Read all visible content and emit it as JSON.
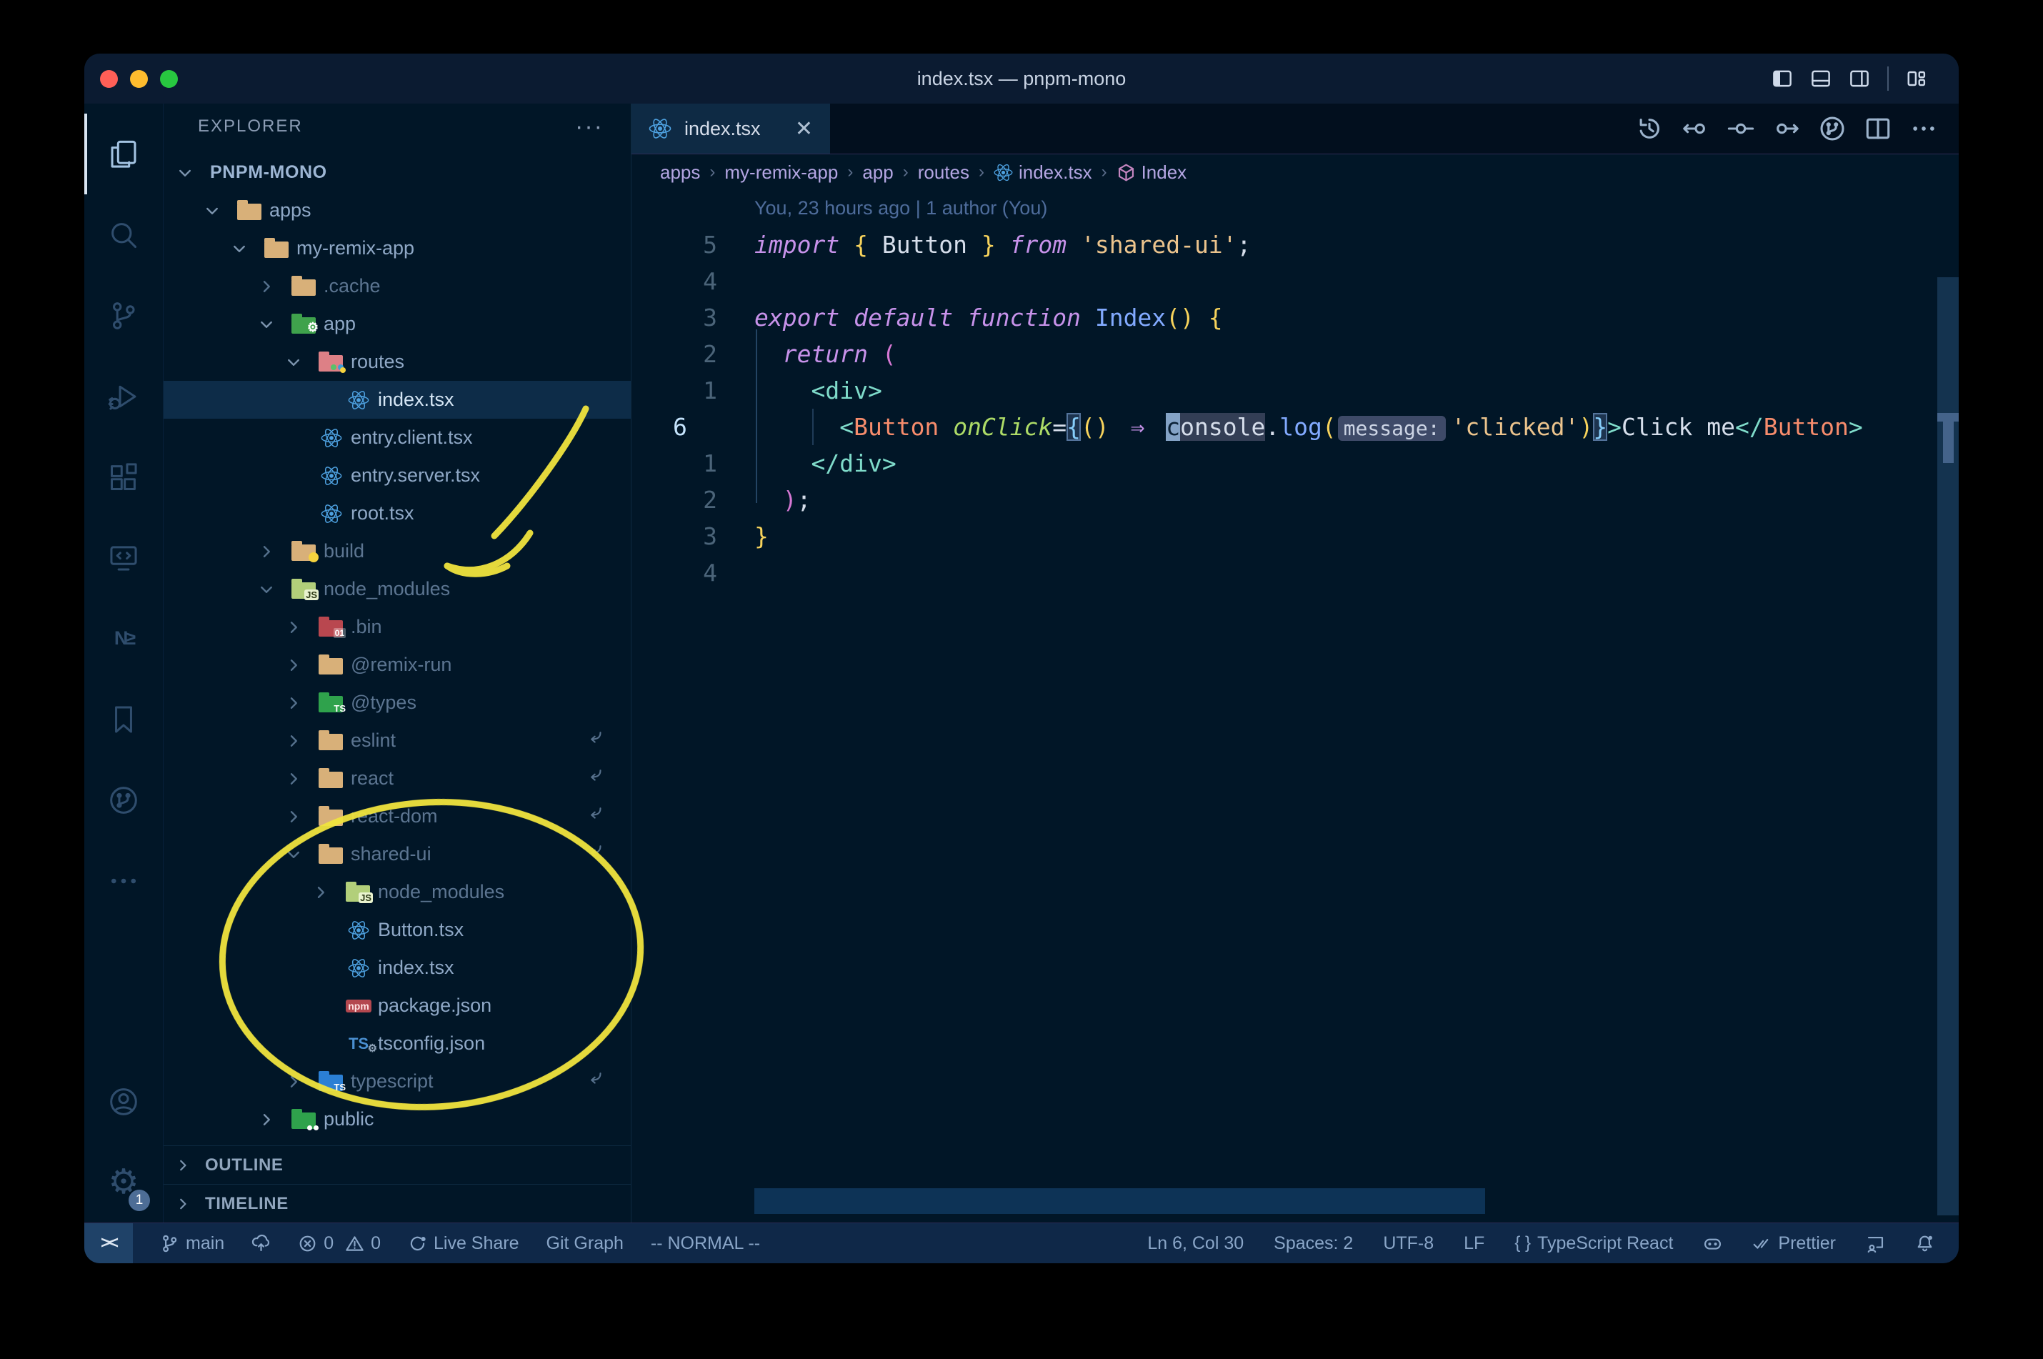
{
  "window": {
    "title": "index.tsx — pnpm-mono"
  },
  "titlebar": {
    "traffic_lights": [
      "#ff5f57",
      "#febc2e",
      "#28c840"
    ],
    "right_icons": [
      "layout-sidebar-left",
      "layout-panel",
      "layout-sidebar-right",
      "sep",
      "layout-custom"
    ]
  },
  "activity_bar": {
    "items": [
      {
        "id": "explorer",
        "icon": "files",
        "active": true
      },
      {
        "id": "search",
        "icon": "search"
      },
      {
        "id": "source-control",
        "icon": "scm"
      },
      {
        "id": "run-debug",
        "icon": "debug"
      },
      {
        "id": "extensions",
        "icon": "ext"
      },
      {
        "id": "remote-explorer",
        "icon": "remote"
      },
      {
        "id": "nx-console",
        "icon": "nx"
      },
      {
        "id": "bookmarks",
        "icon": "bookmarks"
      },
      {
        "id": "git-graph",
        "icon": "gitgraph"
      },
      {
        "id": "more-views",
        "icon": "more"
      },
      {
        "id": "accounts",
        "icon": "account",
        "bottom": true
      },
      {
        "id": "settings",
        "icon": "gear",
        "bottom": true,
        "badge": "1"
      }
    ]
  },
  "sidebar": {
    "header": "EXPLORER",
    "more": "···",
    "sections": [
      {
        "label": "OUTLINE"
      },
      {
        "label": "TIMELINE"
      }
    ],
    "icon_colors": {
      "tan": "#d8b079",
      "green": "#3fa24c",
      "pink": "#dd8086",
      "olive": "#b2cf7a",
      "red": "#b9474f",
      "green2": "#2fa24c",
      "blue": "#2b7fd4"
    },
    "tree": [
      {
        "label": "PNPM-MONO",
        "level": 0,
        "chev": "down",
        "root": true
      },
      {
        "label": "apps",
        "level": 1,
        "chev": "down",
        "icon": "folder",
        "color": "tan"
      },
      {
        "label": "my-remix-app",
        "level": 2,
        "chev": "down",
        "icon": "folder",
        "color": "tan"
      },
      {
        "label": ".cache",
        "level": 3,
        "chev": "right",
        "icon": "folder",
        "color": "tan",
        "dim": true
      },
      {
        "label": "app",
        "level": 3,
        "chev": "down",
        "icon": "folder",
        "color": "green",
        "badge": "gear"
      },
      {
        "label": "routes",
        "level": 4,
        "chev": "down",
        "icon": "folder",
        "color": "pink",
        "badge": "dots"
      },
      {
        "label": "index.tsx",
        "level": 5,
        "icon": "react",
        "selected": true
      },
      {
        "label": "entry.client.tsx",
        "level": 4,
        "icon": "react"
      },
      {
        "label": "entry.server.tsx",
        "level": 4,
        "icon": "react"
      },
      {
        "label": "root.tsx",
        "level": 4,
        "icon": "react"
      },
      {
        "label": "build",
        "level": 3,
        "chev": "right",
        "icon": "folder",
        "color": "tan",
        "badge": "circle",
        "dim": true
      },
      {
        "label": "node_modules",
        "level": 3,
        "chev": "down",
        "icon": "folder",
        "color": "olive",
        "badge": "js",
        "dim": true
      },
      {
        "label": ".bin",
        "level": 4,
        "chev": "right",
        "icon": "folder",
        "color": "red",
        "badge": "bin",
        "dim": true
      },
      {
        "label": "@remix-run",
        "level": 4,
        "chev": "right",
        "icon": "folder",
        "color": "tan",
        "dim": true
      },
      {
        "label": "@types",
        "level": 4,
        "chev": "right",
        "icon": "folder",
        "color": "green2",
        "badge": "TS",
        "dim": true
      },
      {
        "label": "eslint",
        "level": 4,
        "chev": "right",
        "icon": "folder",
        "color": "tan",
        "dim": true,
        "symlink": true
      },
      {
        "label": "react",
        "level": 4,
        "chev": "right",
        "icon": "folder",
        "color": "tan",
        "dim": true,
        "symlink": true
      },
      {
        "label": "react-dom",
        "level": 4,
        "chev": "right",
        "icon": "folder",
        "color": "tan",
        "dim": true,
        "symlink": true
      },
      {
        "label": "shared-ui",
        "level": 4,
        "chev": "down",
        "icon": "folder",
        "color": "tan",
        "dim": true,
        "symlink": true
      },
      {
        "label": "node_modules",
        "level": 5,
        "chev": "right",
        "icon": "folder",
        "color": "olive",
        "badge": "js",
        "dim": true
      },
      {
        "label": "Button.tsx",
        "level": 5,
        "icon": "react"
      },
      {
        "label": "index.tsx",
        "level": 5,
        "icon": "react"
      },
      {
        "label": "package.json",
        "level": 5,
        "icon": "npm"
      },
      {
        "label": "tsconfig.json",
        "level": 5,
        "icon": "tsgear"
      },
      {
        "label": "typescript",
        "level": 4,
        "chev": "right",
        "icon": "folder",
        "color": "blue",
        "badge": "TS",
        "dim": true,
        "symlink": true
      },
      {
        "label": "public",
        "level": 3,
        "chev": "right",
        "icon": "folder",
        "color": "green2",
        "badge": "people"
      }
    ]
  },
  "editor": {
    "tab": {
      "label": "index.tsx",
      "close": "✕"
    },
    "actions": [
      "history",
      "commit-back",
      "commit",
      "commit-fwd",
      "gitgraph",
      "split",
      "more"
    ],
    "breadcrumbs": [
      {
        "label": "apps"
      },
      {
        "label": "my-remix-app"
      },
      {
        "label": "app"
      },
      {
        "label": "routes"
      },
      {
        "label": "index.tsx",
        "icon": "react"
      },
      {
        "label": "Index",
        "icon": "cube"
      }
    ],
    "colors": {
      "kw": "#c792ea",
      "fg": "#d6deeb",
      "fn": "#82aaff",
      "str": "#ecc48d",
      "tag": "#7fdbca",
      "comp": "#f78c6c",
      "attr": "#addb67",
      "b1": "#f7d35c",
      "b2": "#d678d4",
      "b3": "#87cefa"
    },
    "code_lines": [
      {
        "blame": true,
        "text": "You, 23 hours ago | 1 author (You)"
      },
      {
        "n": "5",
        "tokens": [
          [
            "import ",
            "kw",
            1
          ],
          [
            "{ ",
            "b1"
          ],
          [
            "Button ",
            "fg"
          ],
          [
            "} ",
            "b1"
          ],
          [
            "from ",
            "kw",
            1
          ],
          [
            "'shared-ui'",
            "str"
          ],
          [
            ";",
            "fg"
          ]
        ]
      },
      {
        "n": "4",
        "tokens": []
      },
      {
        "n": "3",
        "tokens": [
          [
            "export default function ",
            "kw",
            1
          ],
          [
            "Index",
            "fn"
          ],
          [
            "()",
            "b1"
          ],
          [
            " {",
            "b1"
          ]
        ]
      },
      {
        "n": "2",
        "tokens": [
          [
            "  ",
            ""
          ],
          [
            "return ",
            "kw",
            1
          ],
          [
            "(",
            "b2"
          ]
        ]
      },
      {
        "n": "1",
        "tokens": [
          [
            "    ",
            ""
          ],
          [
            "<div>",
            "tag"
          ]
        ]
      },
      {
        "n": "6",
        "cur": true,
        "tokens": [
          [
            "      ",
            ""
          ],
          [
            "<",
            "tag"
          ],
          [
            "Button",
            "comp"
          ],
          [
            " ",
            ""
          ],
          [
            "onClick",
            "attr",
            1
          ],
          [
            "=",
            "fg"
          ],
          [
            "{",
            "b3",
            0,
            "box"
          ],
          [
            "()",
            "b1"
          ],
          [
            " ",
            ""
          ],
          [
            "⇒",
            "kw",
            0,
            "arrow2"
          ],
          [
            " ",
            ""
          ],
          [
            "c",
            "fg",
            0,
            "cursor"
          ],
          [
            "onsole",
            "fg",
            0,
            "hl"
          ],
          [
            ".",
            "fg"
          ],
          [
            "log",
            "fn"
          ],
          [
            "(",
            "b1"
          ],
          [
            "message:",
            "",
            0,
            "hint"
          ],
          [
            "'clicked'",
            "str"
          ],
          [
            ")",
            "b1"
          ],
          [
            "}",
            "b3",
            0,
            "box"
          ],
          [
            ">",
            "tag"
          ],
          [
            "Click me",
            "fg"
          ],
          [
            "</",
            "tag"
          ],
          [
            "Button",
            "comp"
          ],
          [
            ">",
            "tag"
          ]
        ]
      },
      {
        "n": "1",
        "tokens": [
          [
            "    ",
            ""
          ],
          [
            "</div>",
            "tag"
          ]
        ]
      },
      {
        "n": "2",
        "tokens": [
          [
            "  ",
            ""
          ],
          [
            ")",
            "b2"
          ],
          [
            ";",
            "fg"
          ]
        ]
      },
      {
        "n": "3",
        "tokens": [
          [
            "}",
            "b1"
          ]
        ]
      },
      {
        "n": "4",
        "tokens": []
      }
    ]
  },
  "status_bar": {
    "left": [
      {
        "id": "branch",
        "icon": "branch",
        "label": "main"
      },
      {
        "id": "sync",
        "icon": "sync",
        "label": ""
      },
      {
        "id": "errors",
        "icon": "error",
        "label": "0"
      },
      {
        "id": "warnings",
        "icon": "warn",
        "label": "0"
      },
      {
        "id": "live-share",
        "icon": "liveshare",
        "label": "Live Share"
      },
      {
        "id": "git-graph",
        "label": "Git Graph"
      },
      {
        "id": "vim-mode",
        "label": "-- NORMAL --"
      }
    ],
    "remote_indicator": "><",
    "right": [
      {
        "id": "cursor-position",
        "label": "Ln 6, Col 30"
      },
      {
        "id": "indentation",
        "label": "Spaces: 2"
      },
      {
        "id": "encoding",
        "label": "UTF-8"
      },
      {
        "id": "eol",
        "label": "LF"
      },
      {
        "id": "language",
        "icon": "braces",
        "label": "TypeScript React"
      },
      {
        "id": "copilot",
        "icon": "copilot",
        "label": ""
      },
      {
        "id": "prettier",
        "icon": "dblcheck",
        "label": "Prettier"
      },
      {
        "id": "feedback",
        "icon": "feedback",
        "label": ""
      },
      {
        "id": "notifications",
        "icon": "bell",
        "label": ""
      }
    ]
  },
  "annotations": {
    "color": "#f1e43e"
  }
}
